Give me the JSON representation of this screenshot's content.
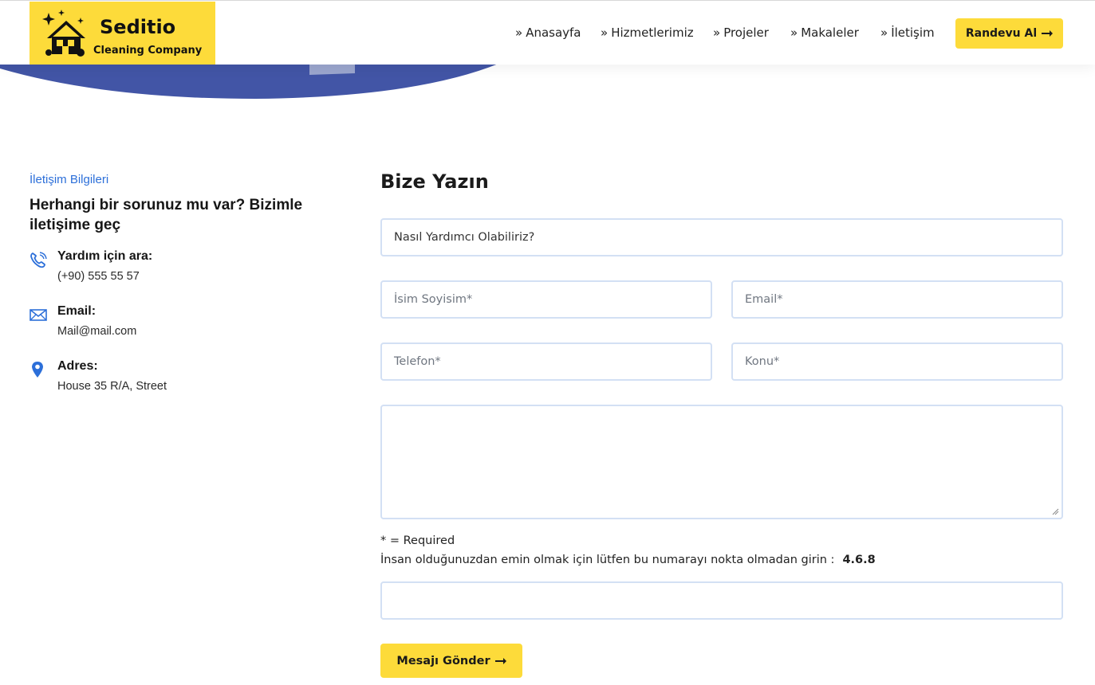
{
  "brand": {
    "title": "Seditio",
    "subtitle": "Cleaning Company",
    "logo_icon": "house-cleaning-icon",
    "accent_color": "#fddb3a",
    "link_color": "#2c6fd9"
  },
  "nav": {
    "prefix": "»",
    "items": [
      {
        "label": "Anasayfa"
      },
      {
        "label": "Hizmetlerimiz"
      },
      {
        "label": "Projeler"
      },
      {
        "label": "Makaleler"
      },
      {
        "label": "İletişim"
      }
    ],
    "cta_label": "Randevu Al",
    "cta_icon": "arrow-right-icon"
  },
  "contact_info": {
    "eyebrow": "İletişim Bilgileri",
    "heading": "Herhangi bir sorunuz mu var? Bizimle iletişime geç",
    "items": [
      {
        "icon": "phone-icon",
        "label": "Yardım için ara:",
        "value": "(+90) 555 55 57"
      },
      {
        "icon": "envelope-icon",
        "label": "Email:",
        "value": "Mail@mail.com"
      },
      {
        "icon": "location-pin-icon",
        "label": "Adres:",
        "value": "House 35 R/A, Street"
      }
    ]
  },
  "form": {
    "title": "Bize Yazın",
    "subject_value": "Nasıl Yardımcı Olabiliriz?",
    "name_placeholder": "İsim Soyisim*",
    "email_placeholder": "Email*",
    "phone_placeholder": "Telefon*",
    "topic_placeholder": "Konu*",
    "message_value": "",
    "required_note": "* = Required",
    "captcha_prompt": "İnsan olduğunuzdan emin olmak için lütfen bu numarayı nokta olmadan girin :",
    "captcha_number": "4.6.8",
    "captcha_value": "",
    "submit_label": "Mesajı Gönder",
    "submit_icon": "arrow-right-icon"
  }
}
